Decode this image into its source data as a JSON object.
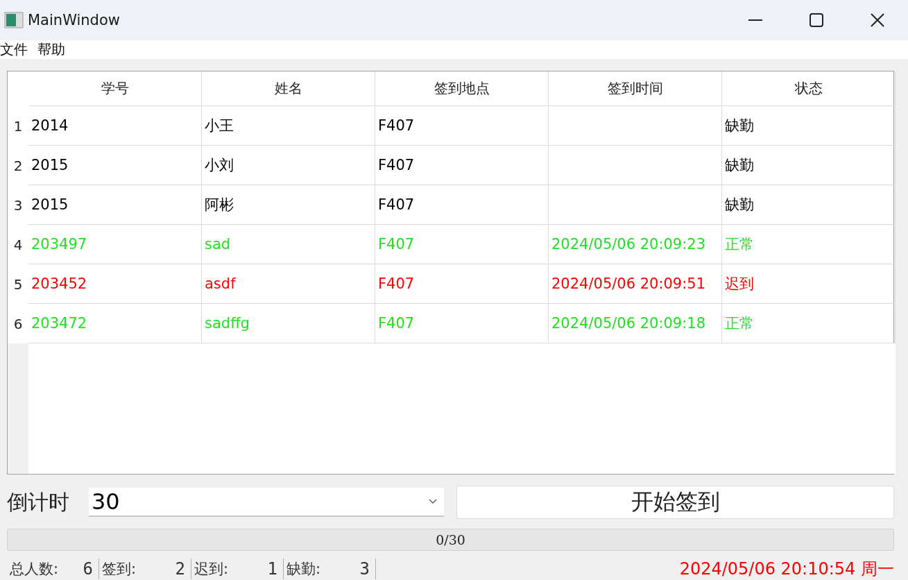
{
  "window": {
    "title": "MainWindow"
  },
  "menu": [
    "文件",
    "帮助"
  ],
  "table": {
    "columns": [
      "学号",
      "姓名",
      "签到地点",
      "签到时间",
      "状态"
    ],
    "rows": [
      {
        "index": "1",
        "cells": [
          "2014",
          "小王",
          "F407",
          "",
          "缺勤"
        ],
        "color": "#000000"
      },
      {
        "index": "2",
        "cells": [
          "2015",
          "小刘",
          "F407",
          "",
          "缺勤"
        ],
        "color": "#000000"
      },
      {
        "index": "3",
        "cells": [
          "2015",
          "阿彬",
          "F407",
          "",
          "缺勤"
        ],
        "color": "#000000"
      },
      {
        "index": "4",
        "cells": [
          "203497",
          "sad",
          "F407",
          "2024/05/06 20:09:23",
          "正常"
        ],
        "color": "#22e022"
      },
      {
        "index": "5",
        "cells": [
          "203452",
          "asdf",
          "F407",
          "2024/05/06 20:09:51",
          "迟到"
        ],
        "color": "#ff0000"
      },
      {
        "index": "6",
        "cells": [
          "203472",
          "sadffg",
          "F407",
          "2024/05/06 20:09:18",
          "正常"
        ],
        "color": "#22e022"
      }
    ]
  },
  "countdown": {
    "label": "倒计时",
    "value": "30"
  },
  "start_button": "开始签到",
  "progress": {
    "level": 0,
    "text": "0/30"
  },
  "stats": [
    {
      "label": "总人数:",
      "value": "6"
    },
    {
      "label": "签到:",
      "value": "2"
    },
    {
      "label": "迟到:",
      "value": "1"
    },
    {
      "label": "缺勤:",
      "value": "3"
    }
  ],
  "datetime": "2024/05/06 20:10:54 周一"
}
